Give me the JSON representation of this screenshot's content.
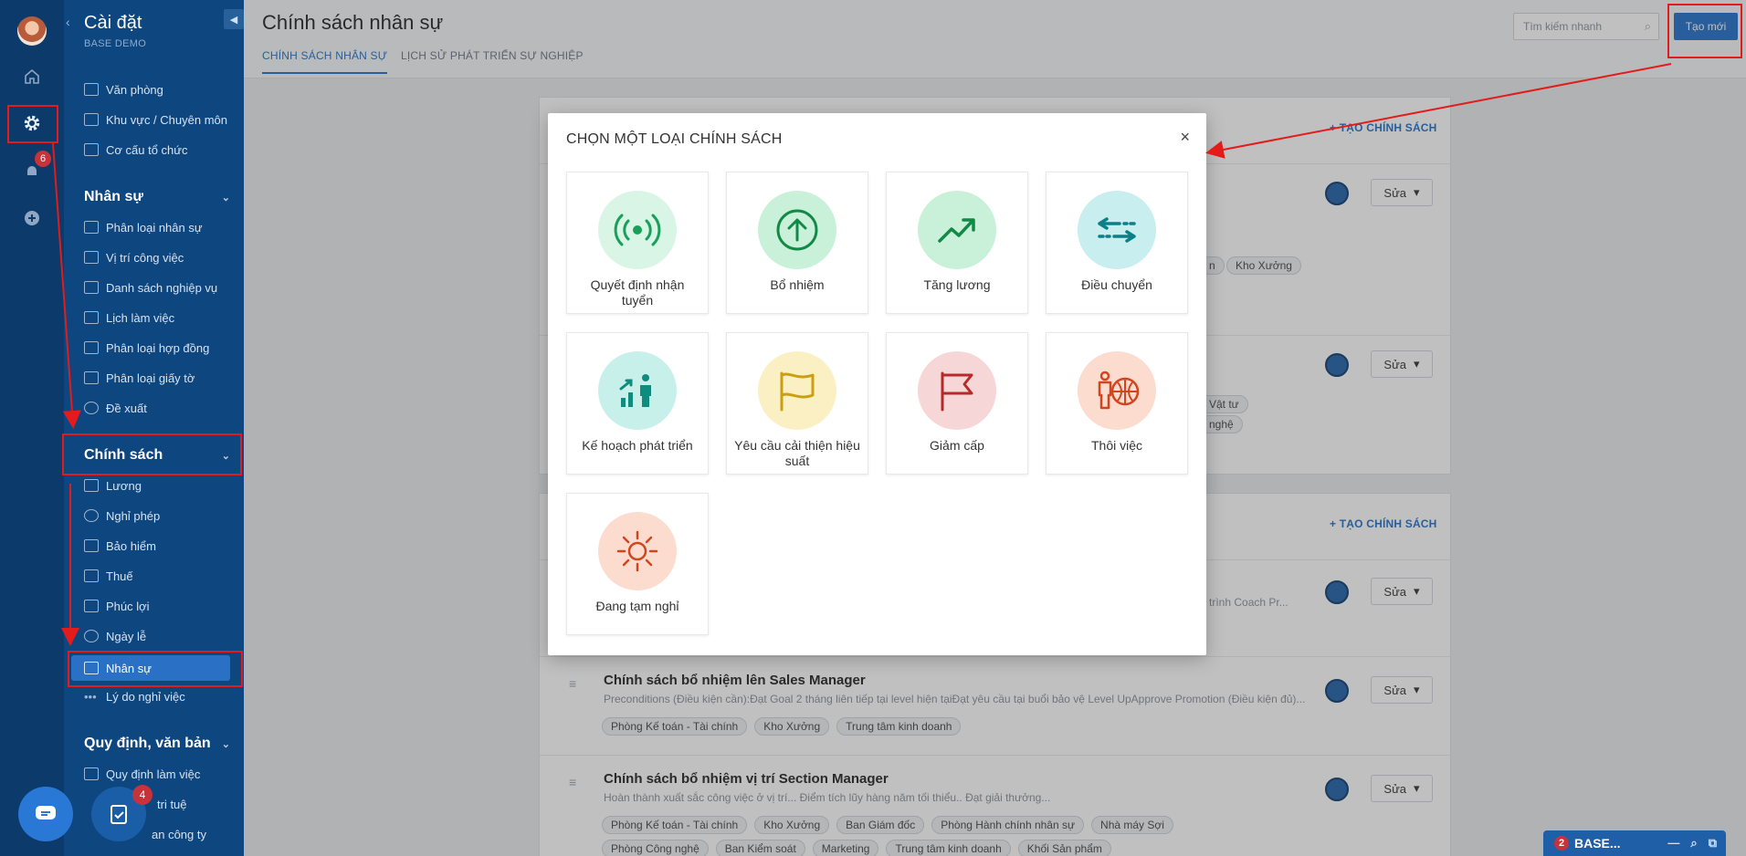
{
  "sidebar": {
    "title": "Cài đặt",
    "subtitle": "BASE DEMO",
    "rail_badge": "6",
    "group1": [
      "Văn phòng",
      "Khu vực / Chuyên môn",
      "Cơ cấu tổ chức"
    ],
    "hr_header": "Nhân sự",
    "hr_items": [
      "Phân loại nhân sự",
      "Vị trí công việc",
      "Danh sách nghiệp vụ",
      "Lịch làm việc",
      "Phân loại hợp đồng",
      "Phân loại giấy tờ",
      "Đề xuất"
    ],
    "policy_header": "Chính sách",
    "policy_items": [
      "Lương",
      "Nghỉ phép",
      "Bảo hiểm",
      "Thuế",
      "Phúc lợi",
      "Ngày lễ",
      "Nhân sự",
      "Lý do nghỉ việc"
    ],
    "rules_header": "Quy định, văn bản",
    "rules_items": [
      "Quy định làm việc",
      "tri tuệ",
      "an công ty"
    ]
  },
  "chat_badge": "4",
  "header": {
    "title": "Chính sách nhân sự",
    "tabs": [
      "CHÍNH SÁCH NHÂN SỰ",
      "LỊCH SỬ PHÁT TRIỂN SỰ NGHIỆP"
    ],
    "search_placeholder": "Tìm kiếm nhanh",
    "new_button": "Tạo mới"
  },
  "content": {
    "add_policy": "+ TẠO CHÍNH SÁCH",
    "edit_label": "Sửa",
    "frag_tags_1": [
      "n",
      "Kho Xưởng"
    ],
    "frag_tags_2": [
      "Vật tư",
      "nghệ"
    ],
    "frag_desc_3": "g trình Coach Pr...",
    "rows": [
      {
        "title": "Chính sách bổ nhiệm lên Sales Manager",
        "desc": "Preconditions (Điều kiện cần):Đạt Goal 2 tháng liên tiếp tại level hiện tạiĐạt yêu cầu tại buổi bảo vệ Level UpApprove Promotion (Điều kiện đủ)...",
        "tags": [
          "Phòng Kế toán - Tài chính",
          "Kho Xưởng",
          "Trung tâm kinh doanh"
        ]
      },
      {
        "title": "Chính sách bổ nhiệm vị trí Section Manager",
        "desc": "Hoàn thành xuất sắc công việc ở vị trí... Điểm tích lũy hàng năm tối thiểu.. Đạt giải thưởng...",
        "tags": [
          "Phòng Kế toán - Tài chính",
          "Kho Xưởng",
          "Ban Giám đốc",
          "Phòng Hành chính nhân sự",
          "Nhà máy Sợi",
          "Phòng Công nghệ",
          "Ban Kiểm soát",
          "Marketing",
          "Trung tâm kinh doanh",
          "Khối Sản phẩm"
        ]
      }
    ]
  },
  "modal": {
    "title": "CHỌN MỘT LOẠI CHÍNH SÁCH",
    "close": "×",
    "options": [
      {
        "label": "Quyết định nhận tuyển",
        "icon": "broadcast-icon",
        "bg": "#d9f5e6",
        "fg": "#18a05a"
      },
      {
        "label": "Bổ nhiệm",
        "icon": "arrow-up-circle-icon",
        "bg": "#c9f0d8",
        "fg": "#128a46"
      },
      {
        "label": "Tăng lương",
        "icon": "trend-up-icon",
        "bg": "#c9f0d8",
        "fg": "#128a46"
      },
      {
        "label": "Điều chuyển",
        "icon": "transfer-arrows-icon",
        "bg": "#c8eef0",
        "fg": "#0d7f86"
      },
      {
        "label": "Kế hoạch phát triển",
        "icon": "growth-person-icon",
        "bg": "#c8f0ea",
        "fg": "#0f8c7d"
      },
      {
        "label": "Yêu cầu cải thiện hiệu suất",
        "icon": "flag-wave-icon",
        "bg": "#fbf0c4",
        "fg": "#c8a012"
      },
      {
        "label": "Giảm cấp",
        "icon": "flag-icon",
        "bg": "#f6d6d6",
        "fg": "#b82a2a"
      },
      {
        "label": "Thôi việc",
        "icon": "person-globe-icon",
        "bg": "#fbdccf",
        "fg": "#d2451e"
      },
      {
        "label": "Đang tạm nghỉ",
        "icon": "sun-icon",
        "bg": "#fbdccf",
        "fg": "#d2451e"
      }
    ]
  },
  "widget": {
    "badge": "2",
    "label": "BASE..."
  }
}
